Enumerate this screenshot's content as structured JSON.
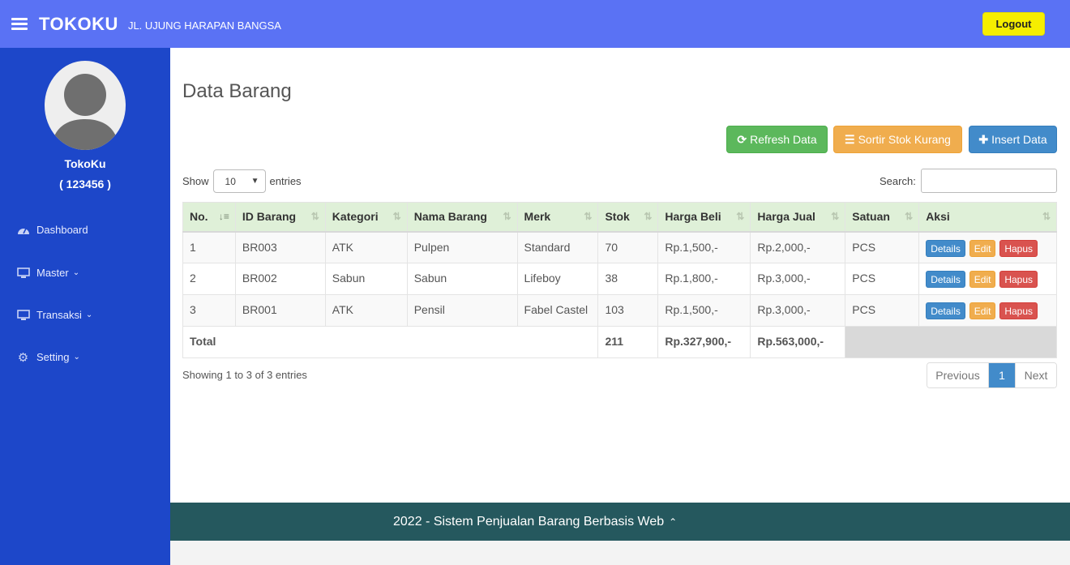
{
  "header": {
    "brand": "TOKOKU",
    "address": "JL. UJUNG HARAPAN BANGSA",
    "logout_label": "Logout"
  },
  "sidebar": {
    "user_name": "TokoKu",
    "user_id": "( 123456 )",
    "items": [
      {
        "label": "Dashboard",
        "icon": "dashboard-icon"
      },
      {
        "label": "Master",
        "icon": "monitor-icon"
      },
      {
        "label": "Transaksi",
        "icon": "monitor-icon"
      },
      {
        "label": "Setting",
        "icon": "gear-icon"
      }
    ]
  },
  "main": {
    "title": "Data Barang",
    "buttons": {
      "refresh": "Refresh Data",
      "sortir": "Sortir Stok Kurang",
      "insert": "Insert Data"
    },
    "show_label": "Show",
    "entries_value": "10",
    "entries_label": "entries",
    "search_label": "Search:",
    "search_value": ""
  },
  "table": {
    "columns": [
      "No.",
      "ID Barang",
      "Kategori",
      "Nama Barang",
      "Merk",
      "Stok",
      "Harga Beli",
      "Harga Jual",
      "Satuan",
      "Aksi"
    ],
    "rows": [
      {
        "no": "1",
        "id": "BR003",
        "kategori": "ATK",
        "nama": "Pulpen",
        "merk": "Standard",
        "stok": "70",
        "beli": "Rp.1,500,-",
        "jual": "Rp.2,000,-",
        "satuan": "PCS"
      },
      {
        "no": "2",
        "id": "BR002",
        "kategori": "Sabun",
        "nama": "Sabun",
        "merk": "Lifeboy",
        "stok": "38",
        "beli": "Rp.1,800,-",
        "jual": "Rp.3,000,-",
        "satuan": "PCS"
      },
      {
        "no": "3",
        "id": "BR001",
        "kategori": "ATK",
        "nama": "Pensil",
        "merk": "Fabel Castel",
        "stok": "103",
        "beli": "Rp.1,500,-",
        "jual": "Rp.3,000,-",
        "satuan": "PCS"
      }
    ],
    "actions": {
      "details": "Details",
      "edit": "Edit",
      "hapus": "Hapus"
    },
    "total": {
      "label": "Total",
      "stok": "211",
      "beli": "Rp.327,900,-",
      "jual": "Rp.563,000,-"
    }
  },
  "pagination": {
    "info": "Showing 1 to 3 of 3 entries",
    "previous": "Previous",
    "current": "1",
    "next": "Next"
  },
  "footer": {
    "text": "2022 - Sistem Penjualan Barang Berbasis Web"
  },
  "colors": {
    "topbar": "#5a72f4",
    "sidebar": "#1d47c9",
    "footer": "#25585e",
    "logout": "#f6ee00"
  }
}
